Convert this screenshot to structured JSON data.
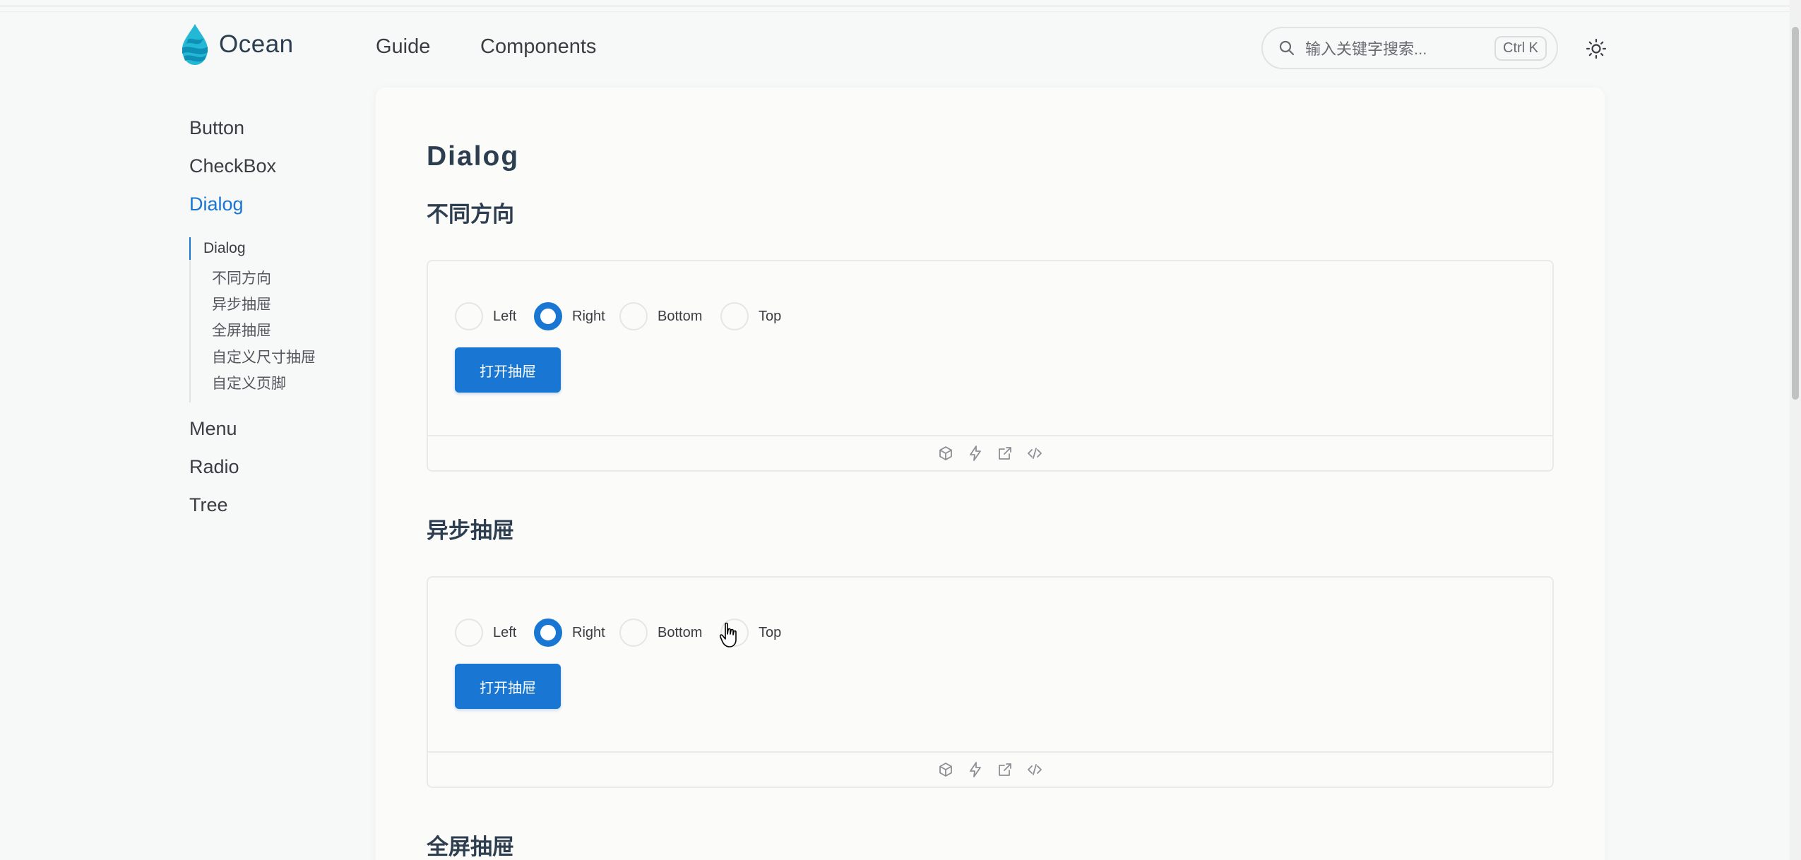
{
  "header": {
    "brand": "Ocean",
    "nav": [
      "Guide",
      "Components"
    ],
    "search_placeholder": "输入关键字搜索...",
    "search_shortcut": "Ctrl K"
  },
  "sidebar": {
    "items_top": [
      "Button",
      "CheckBox",
      "Dialog"
    ],
    "active": "Dialog",
    "sub_items": [
      "Dialog",
      "不同方向",
      "异步抽屉",
      "全屏抽屉",
      "自定义尺寸抽屉",
      "自定义页脚"
    ],
    "items_bottom": [
      "Menu",
      "Radio",
      "Tree"
    ]
  },
  "main": {
    "title": "Dialog",
    "sections": [
      {
        "heading": "不同方向",
        "options": [
          "Left",
          "Right",
          "Bottom",
          "Top"
        ],
        "selected": "Right",
        "button": "打开抽屉"
      },
      {
        "heading": "异步抽屉",
        "options": [
          "Left",
          "Right",
          "Bottom",
          "Top"
        ],
        "selected": "Right",
        "button": "打开抽屉"
      },
      {
        "heading": "全屏抽屉"
      }
    ],
    "demo_tools": [
      "cube-icon",
      "lightning-icon",
      "external-link-icon",
      "code-icon"
    ]
  },
  "colors": {
    "accent": "#1976d2",
    "text": "#3c3c43",
    "heading": "#2c3e50",
    "background": "#f7f8f8"
  }
}
